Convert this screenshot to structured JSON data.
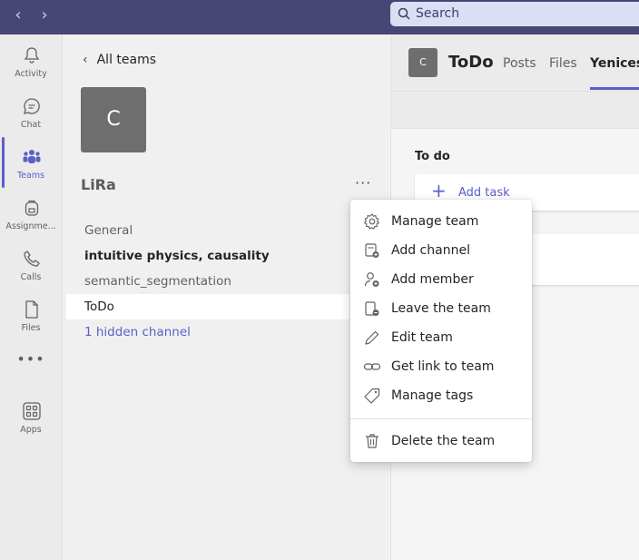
{
  "topbar": {
    "back_icon": "chevron-left-icon",
    "forward_icon": "chevron-right-icon",
    "search": {
      "icon": "search-icon",
      "placeholder": "Search"
    },
    "background": "#464775"
  },
  "rail": {
    "items": [
      {
        "label": "Activity",
        "icon": "bell-icon"
      },
      {
        "label": "Chat",
        "icon": "chat-icon"
      },
      {
        "label": "Teams",
        "icon": "teams-icon",
        "active": true
      },
      {
        "label": "Assignme...",
        "icon": "backpack-icon"
      },
      {
        "label": "Calls",
        "icon": "phone-icon"
      },
      {
        "label": "Files",
        "icon": "file-icon"
      },
      {
        "label": "",
        "icon": "more-icon"
      },
      {
        "label": "Apps",
        "icon": "apps-icon"
      }
    ],
    "accent": "#5b5fc7"
  },
  "panel": {
    "back_label": "All teams",
    "team_avatar_letter": "C",
    "team_name": "LiRa",
    "more_label": "···",
    "channels": [
      {
        "label": "General",
        "style": "normal"
      },
      {
        "label": "intuitive physics, causality",
        "style": "bold"
      },
      {
        "label": "semantic_segmentation",
        "style": "normal"
      },
      {
        "label": "ToDo",
        "style": "active"
      },
      {
        "label": "1 hidden channel",
        "style": "link"
      }
    ]
  },
  "main": {
    "avatar_letter": "C",
    "title": "ToDo",
    "tabs": [
      {
        "label": "Posts"
      },
      {
        "label": "Files"
      },
      {
        "label": "Yenicesu",
        "active": true
      }
    ],
    "column_title": "To do",
    "add_task_label": "Add task"
  },
  "context_menu": {
    "items": [
      {
        "label": "Manage team",
        "icon": "gear-icon"
      },
      {
        "label": "Add channel",
        "icon": "add-channel-icon"
      },
      {
        "label": "Add member",
        "icon": "add-member-icon"
      },
      {
        "label": "Leave the team",
        "icon": "leave-icon"
      },
      {
        "label": "Edit team",
        "icon": "pencil-icon"
      },
      {
        "label": "Get link to team",
        "icon": "link-icon"
      },
      {
        "label": "Manage tags",
        "icon": "tag-icon"
      }
    ],
    "danger_item": {
      "label": "Delete the team",
      "icon": "trash-icon"
    }
  }
}
